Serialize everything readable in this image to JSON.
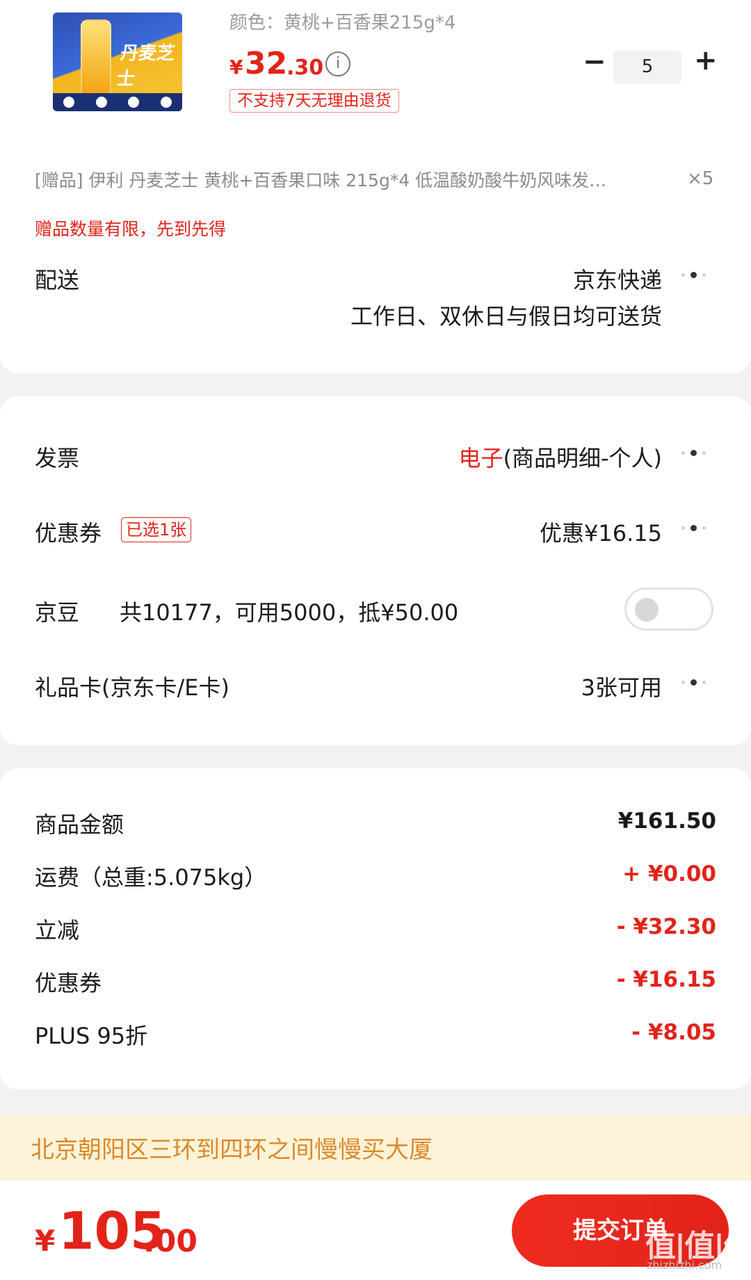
{
  "product": {
    "image_alt": "丹麦芝士",
    "variant": "颜色：黄桃+百香果215g*4",
    "price_symbol": "¥",
    "price_int": "32",
    "price_dec": ".30",
    "info_icon": "i",
    "no_return": "不支持7天无理由退货",
    "qty": "5",
    "minus": "−",
    "plus": "+"
  },
  "gift": {
    "text": "[赠品]  伊利 丹麦芝士 黄桃+百香果口味 215g*4 低温酸奶酸牛奶风味发…",
    "count": "×5",
    "limit_notice": "赠品数量有限，先到先得"
  },
  "delivery": {
    "label": "配送",
    "carrier": "京东快递",
    "schedule": "工作日、双休日与假日均可送货"
  },
  "invoice": {
    "label": "发票",
    "type": "电子",
    "detail": "(商品明细-个人)"
  },
  "coupon": {
    "label": "优惠券",
    "badge": "已选1张",
    "value": "优惠¥16.15"
  },
  "jingdou": {
    "label": "京豆",
    "detail": "共10177，可用5000，抵¥50.00",
    "enabled": false
  },
  "giftcard": {
    "label": "礼品卡(京东卡/E卡)",
    "value": "3张可用"
  },
  "summary": [
    {
      "label": "商品金额",
      "value": "¥161.50",
      "color": "#1a1a1a"
    },
    {
      "label": "运费（总重:5.075kg）",
      "value": "+ ¥0.00",
      "color": "#e2231a"
    },
    {
      "label": "立减",
      "value": "- ¥32.30",
      "color": "#e2231a"
    },
    {
      "label": "优惠券",
      "value": "- ¥16.15",
      "color": "#e2231a"
    },
    {
      "label": "PLUS 95折",
      "value": "- ¥8.05",
      "color": "#e2231a"
    }
  ],
  "address": "北京朝阳区三环到四环之间慢慢买大厦",
  "total": {
    "symbol": "¥",
    "int": "105",
    "dec": ".00"
  },
  "submit_label": "提交订单",
  "watermark": {
    "logo": "值|值|值",
    "url": "zhizhizhi.com"
  },
  "colors": {
    "accent": "#e2231a",
    "address_text": "#d98a2b",
    "address_bg": "#fdf3d8"
  }
}
